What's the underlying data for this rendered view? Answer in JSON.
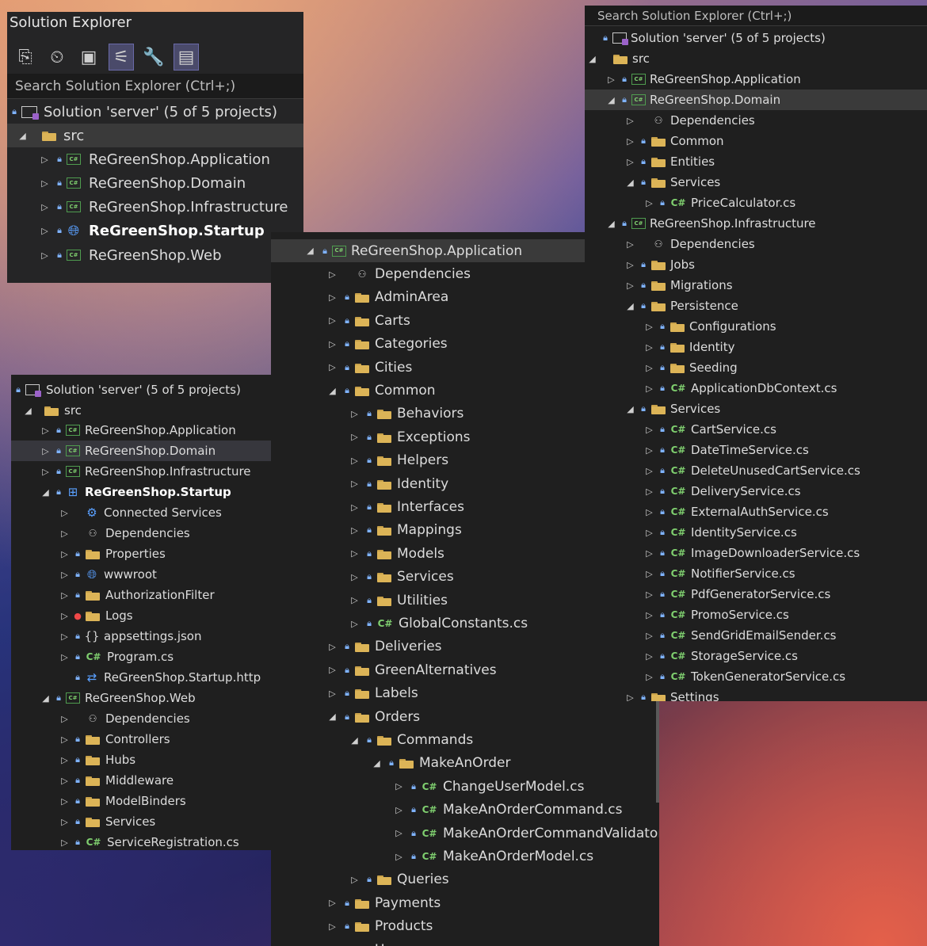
{
  "panel1": {
    "title": "Solution Explorer",
    "search_placeholder": "Search Solution Explorer (Ctrl+;)",
    "solution": "Solution 'server' (5 of 5 projects)",
    "src": "src",
    "projects": [
      "ReGreenShop.Application",
      "ReGreenShop.Domain",
      "ReGreenShop.Infrastructure",
      "ReGreenShop.Startup",
      "ReGreenShop.Web"
    ]
  },
  "panel2": {
    "solution": "Solution 'server' (5 of 5 projects)",
    "src": "src",
    "items": [
      "ReGreenShop.Application",
      "ReGreenShop.Domain",
      "ReGreenShop.Infrastructure",
      "ReGreenShop.Startup",
      "Connected Services",
      "Dependencies",
      "Properties",
      "wwwroot",
      "AuthorizationFilter",
      "Logs",
      "appsettings.json",
      "Program.cs",
      "ReGreenShop.Startup.http",
      "ReGreenShop.Web",
      "Dependencies",
      "Controllers",
      "Hubs",
      "Middleware",
      "ModelBinders",
      "Services",
      "ServiceRegistration.cs"
    ]
  },
  "panel3": {
    "items": [
      "ReGreenShop.Application",
      "Dependencies",
      "AdminArea",
      "Carts",
      "Categories",
      "Cities",
      "Common",
      "Behaviors",
      "Exceptions",
      "Helpers",
      "Identity",
      "Interfaces",
      "Mappings",
      "Models",
      "Services",
      "Utilities",
      "GlobalConstants.cs",
      "Deliveries",
      "GreenAlternatives",
      "Labels",
      "Orders",
      "Commands",
      "MakeAnOrder",
      "ChangeUserModel.cs",
      "MakeAnOrderCommand.cs",
      "MakeAnOrderCommandValidator",
      "MakeAnOrderModel.cs",
      "Queries",
      "Payments",
      "Products",
      "Users"
    ]
  },
  "panel4": {
    "search_placeholder": "Search Solution Explorer (Ctrl+;)",
    "items": [
      "Solution 'server' (5 of 5 projects)",
      "src",
      "ReGreenShop.Application",
      "ReGreenShop.Domain",
      "Dependencies",
      "Common",
      "Entities",
      "Services",
      "PriceCalculator.cs",
      "ReGreenShop.Infrastructure",
      "Dependencies",
      "Jobs",
      "Migrations",
      "Persistence",
      "Configurations",
      "Identity",
      "Seeding",
      "ApplicationDbContext.cs",
      "Services",
      "CartService.cs",
      "DateTimeService.cs",
      "DeleteUnusedCartService.cs",
      "DeliveryService.cs",
      "ExternalAuthService.cs",
      "IdentityService.cs",
      "ImageDownloaderService.cs",
      "NotifierService.cs",
      "PdfGeneratorService.cs",
      "PromoService.cs",
      "SendGridEmailSender.cs",
      "StorageService.cs",
      "TokenGeneratorService.cs",
      "Settings"
    ]
  }
}
